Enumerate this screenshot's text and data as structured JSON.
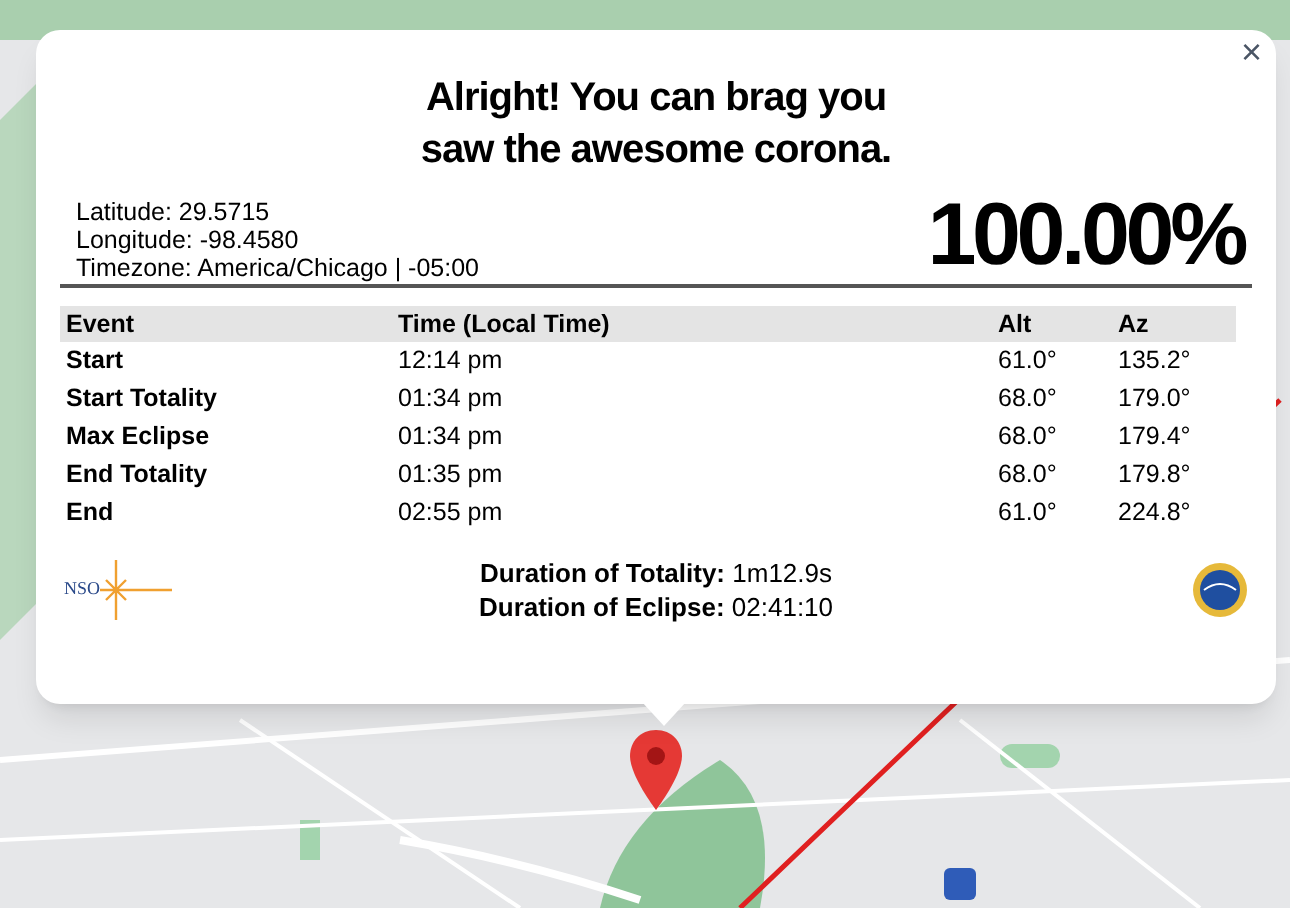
{
  "popup": {
    "title_lines": [
      "Alright! You can brag you",
      "saw the awesome corona."
    ],
    "close": "×",
    "location": [
      "Latitude: 29.5715",
      "Longitude: -98.4580",
      "Timezone: America/Chicago | -05:00"
    ],
    "coverage": "100.00%",
    "table": {
      "columns": [
        "Event",
        "Time (Local Time)",
        "Alt",
        "Az"
      ],
      "rows": [
        {
          "event": "Start",
          "time": "12:14 pm",
          "alt": "61.0°",
          "az": "135.2°"
        },
        {
          "event": "Start Totality",
          "time": "01:34 pm",
          "alt": "68.0°",
          "az": "179.0°"
        },
        {
          "event": "Max Eclipse",
          "time": "01:34 pm",
          "alt": "68.0°",
          "az": "179.4°"
        },
        {
          "event": "End Totality",
          "time": "01:35 pm",
          "alt": "68.0°",
          "az": "179.8°"
        },
        {
          "event": "End",
          "time": "02:55 pm",
          "alt": "61.0°",
          "az": "224.8°"
        }
      ]
    },
    "durations": [
      {
        "label": "Duration of Totality:",
        "value": "1m12.9s"
      },
      {
        "label": "Duration of Eclipse:",
        "value": "02:41:10"
      }
    ],
    "left_logo": "NSO"
  }
}
